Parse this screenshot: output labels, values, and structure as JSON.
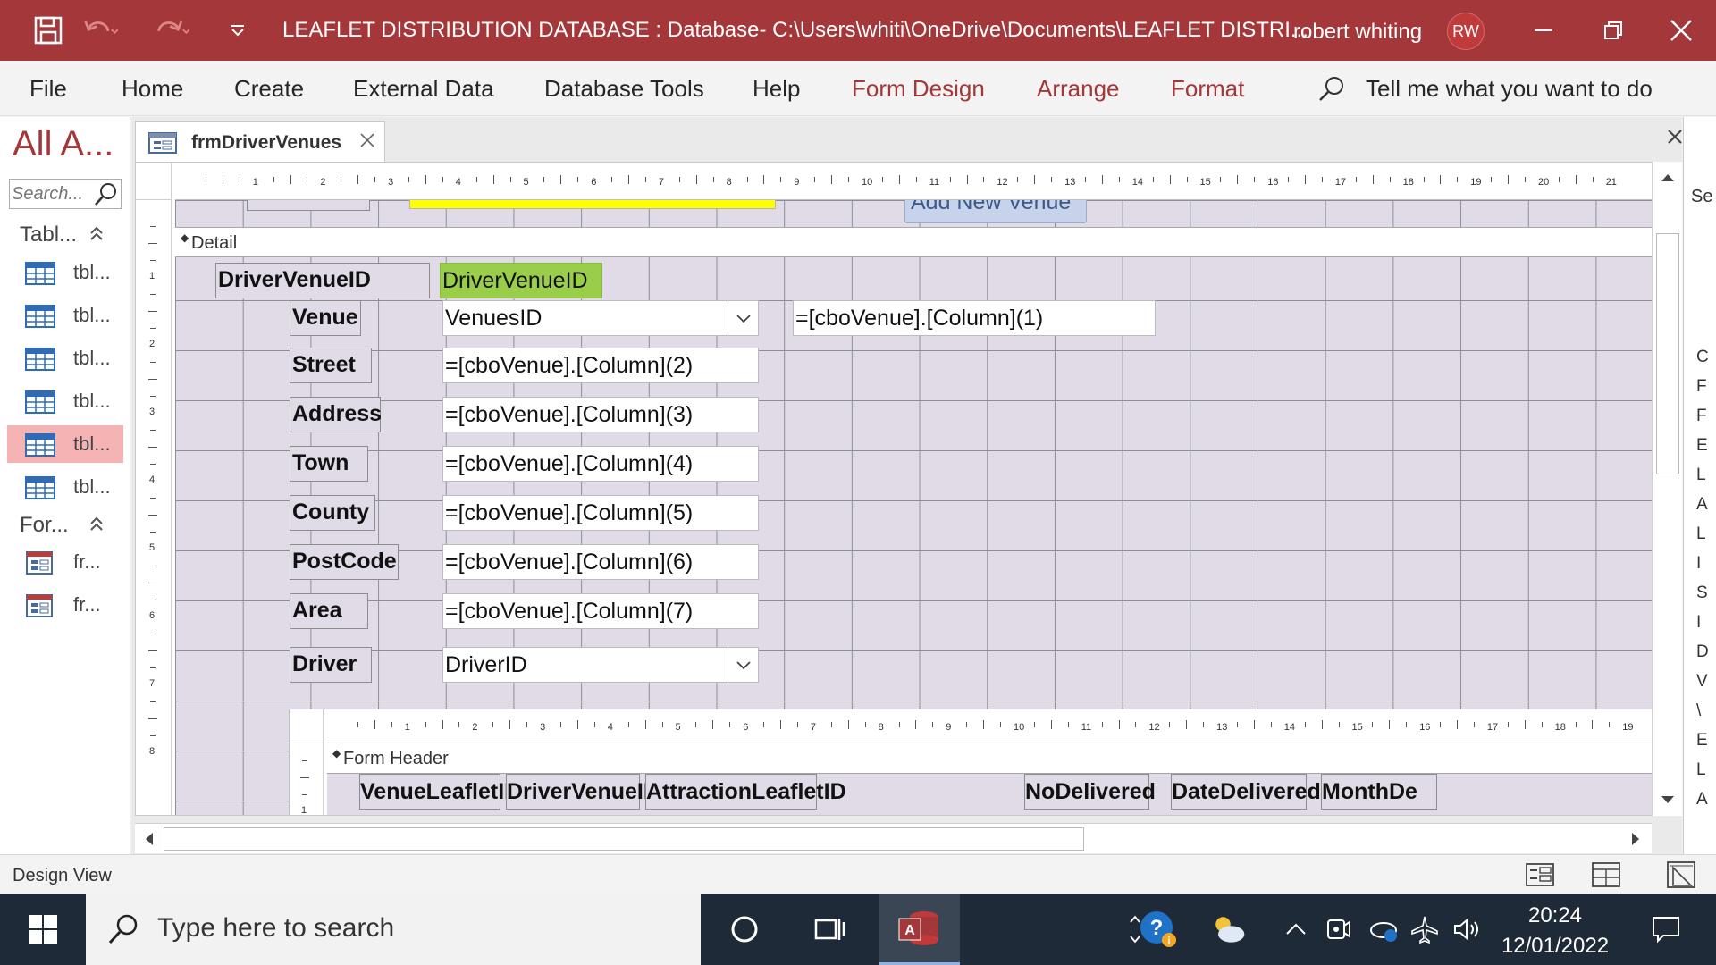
{
  "titlebar": {
    "title": "LEAFLET DISTRIBUTION DATABASE : Database- C:\\Users\\whiti\\OneDrive\\Documents\\LEAFLET DISTRI...",
    "user_name": "robert whiting",
    "user_initials": "RW"
  },
  "ribbon": {
    "tabs": [
      "File",
      "Home",
      "Create",
      "External Data",
      "Database Tools",
      "Help",
      "Form Design",
      "Arrange",
      "Format"
    ],
    "tell_me": "Tell me what you want to do"
  },
  "nav": {
    "title": "All A...",
    "search_placeholder": "Search...",
    "tables_group": "Tabl...",
    "forms_group": "For...",
    "tables": [
      "tbl...",
      "tbl...",
      "tbl...",
      "tbl...",
      "tbl...",
      "tbl..."
    ],
    "forms": [
      "fr...",
      "fr..."
    ]
  },
  "doc": {
    "tab_label": "frmDriverVenues"
  },
  "designer": {
    "top_button": "Add New Venue",
    "detail_section": "Detail",
    "fields": {
      "driver_venue_id_label": "DriverVenueID",
      "driver_venue_id_value": "DriverVenueID",
      "venue_label": "Venue",
      "venue_value": "VenuesID",
      "venue_col1": "=[cboVenue].[Column](1)",
      "street_label": "Street",
      "street_value": "=[cboVenue].[Column](2)",
      "address_label": "Address",
      "address_value": "=[cboVenue].[Column](3)",
      "town_label": "Town",
      "town_value": "=[cboVenue].[Column](4)",
      "county_label": "County",
      "county_value": "=[cboVenue].[Column](5)",
      "postcode_label": "PostCode",
      "postcode_value": "=[cboVenue].[Column](6)",
      "area_label": "Area",
      "area_value": "=[cboVenue].[Column](7)",
      "driver_label": "Driver",
      "driver_value": "DriverID"
    },
    "subform": {
      "header_section": "Form Header",
      "columns": [
        "VenueLeafletID",
        "DriverVenueID",
        "AttractionLeafletID",
        "NoDelivered",
        "DateDelivered",
        "MonthDe"
      ]
    }
  },
  "property_sheet": {
    "label": "Se",
    "chars": [
      "C",
      "F",
      "F",
      "E",
      "L",
      "A",
      "L",
      "I",
      "S",
      "I",
      "D",
      "V",
      "\\",
      "E",
      "L",
      "A"
    ]
  },
  "statusbar": {
    "view": "Design View"
  },
  "taskbar": {
    "search_placeholder": "Type here to search",
    "time": "20:24",
    "date": "12/01/2022"
  },
  "colors": {
    "accent": "#a4373a",
    "highlight_yellow": "#ffff00",
    "field_green": "#9acd4a",
    "grid_bg": "#e0dbe6",
    "nav_selected": "#f5b3b4"
  }
}
